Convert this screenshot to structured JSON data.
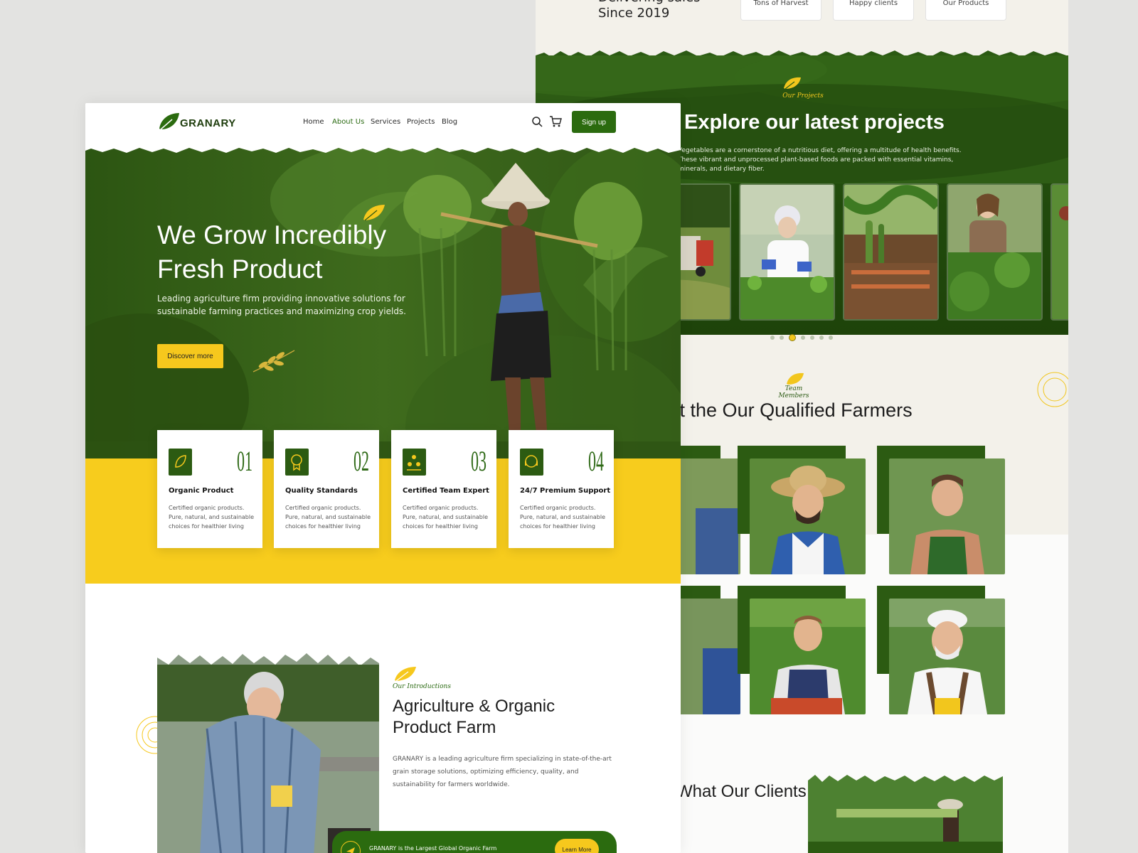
{
  "colors": {
    "brand_green": "#2b6b0f",
    "dark_green": "#214a0c",
    "accent_yellow": "#f7cc1d",
    "page_bg": "#e3e3e1"
  },
  "back_page": {
    "since_label": "Delivering sales",
    "since_year": "Since 2019",
    "stats": [
      "Tons of Harvest",
      "Happy clients",
      "Our Products"
    ],
    "projects": {
      "eyebrow": "Our Projects",
      "title": "Explore our latest projects",
      "description": "Vegetables are a cornerstone of a nutritious diet, offering a multitude of health benefits. These vibrant and unprocessed plant-based foods are packed with essential vitamins, minerals, and dietary fiber.",
      "slider_dots": 7,
      "active_dot": 3
    },
    "team": {
      "eyebrow": "Team Members",
      "title": "Meet the Our Qualified Farmers"
    },
    "testimonials_title": "What Our Clients Say"
  },
  "front_page": {
    "brand": "GRANARY",
    "nav": [
      "Home",
      "About Us",
      "Services",
      "Projects",
      "Blog"
    ],
    "active_nav": "About Us",
    "signup_label": "Sign up",
    "hero": {
      "title": "We Grow Incredibly Fresh Product",
      "subtitle": "Leading agriculture firm providing innovative solutions for sustainable farming practices and maximizing crop yields.",
      "cta": "Discover more"
    },
    "features": [
      {
        "num": "01",
        "title": "Organic Product",
        "text": "Certified organic products. Pure, natural, and sustainable choices for healthier living",
        "icon": "organic-leaf-icon"
      },
      {
        "num": "02",
        "title": "Quality Standards",
        "text": "Certified organic products. Pure, natural, and sustainable choices for healthier living",
        "icon": "quality-badge-icon"
      },
      {
        "num": "03",
        "title": "Certified Team Expert",
        "text": "Certified organic products. Pure, natural, and sustainable choices for healthier living",
        "icon": "team-icon"
      },
      {
        "num": "04",
        "title": "24/7 Premium Support",
        "text": "Certified organic products. Pure, natural, and sustainable choices for healthier living",
        "icon": "support-icon"
      }
    ],
    "about": {
      "eyebrow": "Our Introductions",
      "title": "Agriculture & Organic Product Farm",
      "text": "GRANARY is a leading agriculture firm specializing in state-of-the-art grain storage solutions, optimizing efficiency, quality, and sustainability for farmers worldwide."
    },
    "bottom_bar": {
      "text": "GRANARY is the Largest Global Organic Farm",
      "button": "Learn More"
    }
  }
}
